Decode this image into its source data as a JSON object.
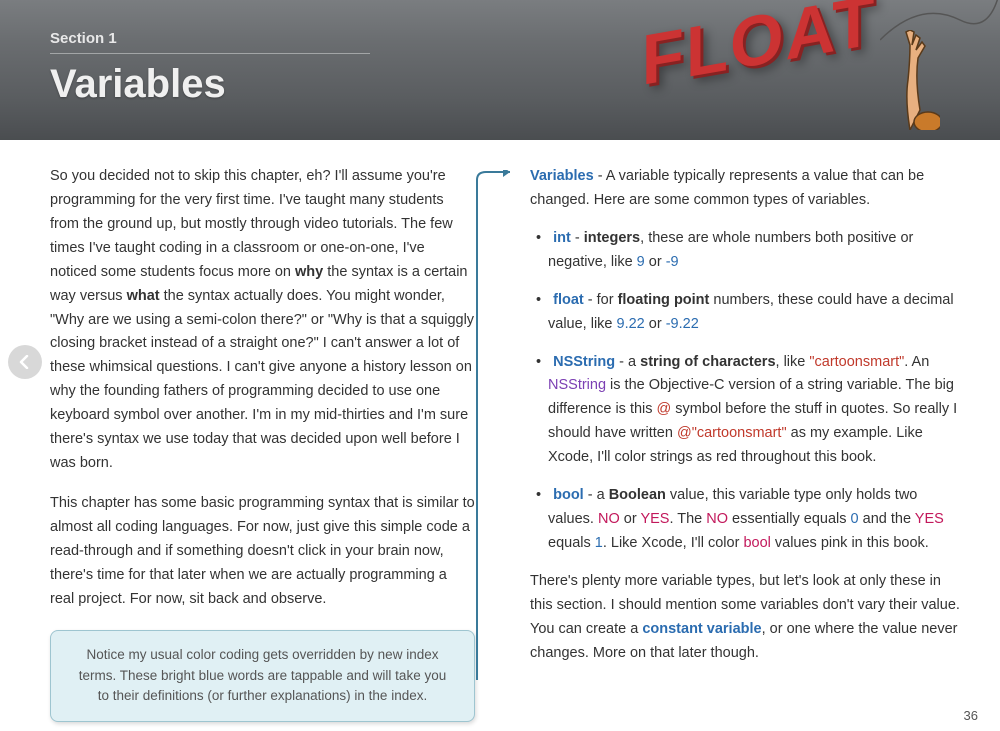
{
  "header": {
    "section": "Section 1",
    "title": "Variables",
    "float_word": "FLOAT"
  },
  "left": {
    "p1a": "So you decided not to skip this chapter, eh? I'll assume you're programming for the very first time. I've taught many students from the ground up, but mostly through video tutorials. The few times I've taught coding in a classroom or one-on-one, I've noticed some students focus more on ",
    "p1b_why": "why",
    "p1c": " the syntax is a certain way versus ",
    "p1d_what": "what",
    "p1e": " the syntax actually does. You might wonder, \"Why are we using a semi-colon there?\" or \"Why is that a squiggly closing bracket instead of a straight one?\"  I can't answer a lot of these whimsical questions. I can't give anyone a history lesson on why the founding fathers of programming decided to use one keyboard symbol over another. I'm in my mid-thirties and I'm sure there's syntax we use today that was decided upon well before I was born.",
    "p2": "This chapter has some basic programming syntax that is similar to almost all coding languages. For now, just give this simple code a read-through and if something doesn't click in your brain now, there's time for that later when we are actually programming a real project.  For now, sit back and observe.",
    "callout": "Notice my usual color coding gets overridden by new index terms. These bright blue words are tappable and will take you to their definitions (or further explanations) in the index."
  },
  "right": {
    "intro_label": "Variables",
    "intro_text": " - A variable typically represents a value that can be changed. Here are some common types of variables.",
    "int": {
      "kw": "int",
      "dash": " - ",
      "b": "integers",
      "t1": ", these are whole numbers both positive or negative, like ",
      "n1": "9",
      "t2": " or ",
      "n2": "-9"
    },
    "float": {
      "kw": "float",
      "dash": " - for ",
      "b": "floating point",
      "t1": " numbers, these could have a decimal value, like ",
      "n1": "9.22",
      "t2": " or ",
      "n2": "-9.22"
    },
    "nsstring": {
      "kw": "NSString",
      "dash": " - a ",
      "b": "string of characters",
      "t1": ", like ",
      "s1": "\"cartoonsmart\"",
      "t2": ". An ",
      "kw2": "NSString",
      "t3": " is the Objective-C version of a string variable. The big difference is this ",
      "at": "@",
      "t4": " symbol before the stuff in quotes. So really I should have written ",
      "s2": "@\"cartoonsmart\"",
      "t5": " as my example. Like Xcode, I'll color strings as red throughout this book."
    },
    "bool": {
      "kw": "bool",
      "dash": " - a ",
      "b": "Boolean",
      "t1": " value, this variable type only holds two values. ",
      "no": "NO",
      "t2": " or ",
      "yes": "YES",
      "t3": ". The ",
      "no2": "NO",
      "t4": " essentially equals ",
      "z": "0",
      "t5": " and the ",
      "yes2": "YES",
      "t6": " equals ",
      "one": "1",
      "t7": ". Like Xcode, I'll color ",
      "boolw": "bool",
      "t8": " values pink in this book."
    },
    "outro_a": "There's plenty more variable types, but let's look at only these in this section. I should mention some variables don't vary their value. You can create a ",
    "outro_const": "constant variable",
    "outro_b": ", or one where the value never changes. More on that later though."
  },
  "page_number": "36"
}
